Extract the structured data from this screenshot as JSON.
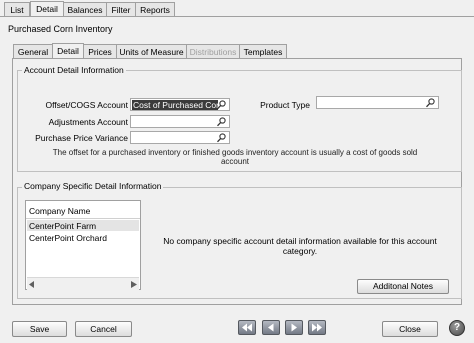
{
  "top_tabs": [
    "List",
    "Detail",
    "Balances",
    "Filter",
    "Reports"
  ],
  "record_title": "Purchased Corn Inventory",
  "sub_tabs": [
    "General",
    "Detail",
    "Prices",
    "Units of Measure",
    "Distributions",
    "Templates"
  ],
  "account_group": {
    "title": "Account Detail Information",
    "offset_label": "Offset/COGS Account",
    "offset_value": "Cost of Purchased Corn",
    "adjustments_label": "Adjustments Account",
    "ppv_label": "Purchase Price Variance",
    "product_type_label": "Product Type",
    "help_text": "The offset for a purchased inventory or finished goods inventory account is usually a cost of goods sold account"
  },
  "company_group": {
    "title": "Company Specific Detail Information",
    "list_header": "Company Name",
    "companies": [
      "CenterPoint Farm",
      "CenterPoint Orchard"
    ],
    "empty_message": "No company specific account detail information available for this account category.",
    "notes_button": "Additonal Notes"
  },
  "footer": {
    "save": "Save",
    "cancel": "Cancel",
    "close": "Close",
    "help": "?"
  }
}
